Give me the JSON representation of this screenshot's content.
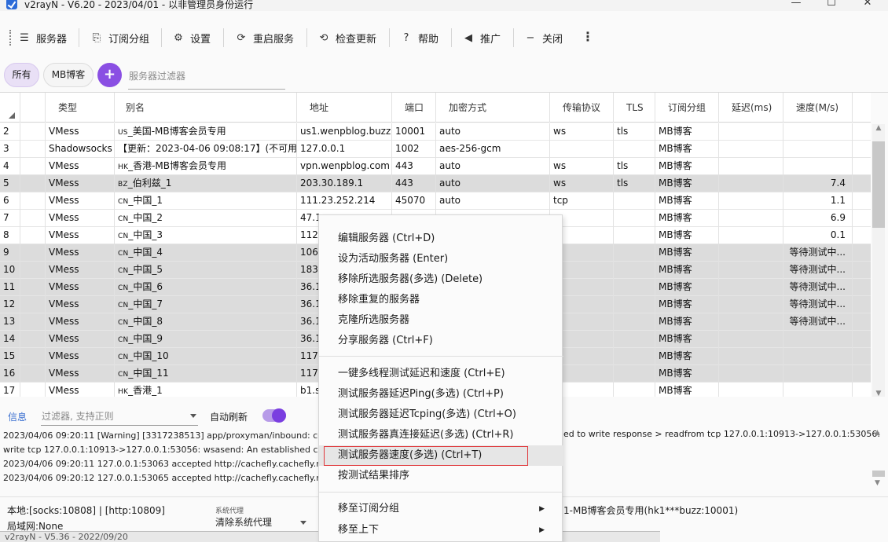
{
  "window": {
    "title": "v2rayN - V6.20 - 2023/04/01 - 以非管理员身份运行",
    "min": "—",
    "max": "☐",
    "close": "✕"
  },
  "toolbar": {
    "servers": "服务器",
    "subs": "订阅分组",
    "settings": "设置",
    "restart": "重启服务",
    "update": "检查更新",
    "help": "帮助",
    "promo": "推广",
    "close": "关闭",
    "more": "⋮"
  },
  "filters": {
    "all": "所有",
    "mb": "MB博客",
    "add": "+",
    "placeholder": "服务器过滤器"
  },
  "grid": {
    "headers": [
      "类型",
      "别名",
      "地址",
      "端口",
      "加密方式",
      "传输协议",
      "TLS",
      "订阅分组",
      "延迟(ms)",
      "速度(M/s)"
    ],
    "rows": [
      {
        "n": "2",
        "type": "VMess",
        "cc": "US",
        "alias": "_美国-MB博客会员专用",
        "addr": "us1.wenpblog.buzz",
        "port": "10001",
        "enc": "auto",
        "net": "ws",
        "tls": "tls",
        "sub": "MB博客",
        "delay": "",
        "speed": "",
        "sel": false
      },
      {
        "n": "3",
        "type": "Shadowsocks",
        "cc": "",
        "alias": "【更新：2023-04-06 09:08:17】(不可用)",
        "addr": "127.0.0.1",
        "port": "1002",
        "enc": "aes-256-gcm",
        "net": "",
        "tls": "",
        "sub": "MB博客",
        "delay": "",
        "speed": "",
        "sel": false
      },
      {
        "n": "4",
        "type": "VMess",
        "cc": "HK",
        "alias": "_香港-MB博客会员专用",
        "addr": "vpn.wenpblog.com",
        "port": "443",
        "enc": "auto",
        "net": "ws",
        "tls": "tls",
        "sub": "MB博客",
        "delay": "",
        "speed": "",
        "sel": false
      },
      {
        "n": "5",
        "type": "VMess",
        "cc": "BZ",
        "alias": "_伯利兹_1",
        "addr": "203.30.189.1",
        "port": "443",
        "enc": "auto",
        "net": "ws",
        "tls": "tls",
        "sub": "MB博客",
        "delay": "",
        "speed": "7.4",
        "sel": true
      },
      {
        "n": "6",
        "type": "VMess",
        "cc": "CN",
        "alias": "_中国_1",
        "addr": "111.23.252.214",
        "port": "45070",
        "enc": "auto",
        "net": "tcp",
        "tls": "",
        "sub": "MB博客",
        "delay": "",
        "speed": "1.1",
        "sel": false
      },
      {
        "n": "7",
        "type": "VMess",
        "cc": "CN",
        "alias": "_中国_2",
        "addr": "47.1",
        "port": "",
        "enc": "",
        "net": "p",
        "tls": "",
        "sub": "MB博客",
        "delay": "",
        "speed": "6.9",
        "sel": false
      },
      {
        "n": "8",
        "type": "VMess",
        "cc": "CN",
        "alias": "_中国_3",
        "addr": "112.",
        "port": "",
        "enc": "",
        "net": "p",
        "tls": "",
        "sub": "MB博客",
        "delay": "",
        "speed": "0.1",
        "sel": false
      },
      {
        "n": "9",
        "type": "VMess",
        "cc": "CN",
        "alias": "_中国_4",
        "addr": "106.",
        "port": "",
        "enc": "",
        "net": "p",
        "tls": "",
        "sub": "MB博客",
        "delay": "",
        "speed": "等待测试中...",
        "sel": true
      },
      {
        "n": "10",
        "type": "VMess",
        "cc": "CN",
        "alias": "_中国_5",
        "addr": "183.",
        "port": "",
        "enc": "",
        "net": "p",
        "tls": "",
        "sub": "MB博客",
        "delay": "",
        "speed": "等待测试中...",
        "sel": true
      },
      {
        "n": "11",
        "type": "VMess",
        "cc": "CN",
        "alias": "_中国_6",
        "addr": "36.1",
        "port": "",
        "enc": "",
        "net": "p",
        "tls": "",
        "sub": "MB博客",
        "delay": "",
        "speed": "等待测试中...",
        "sel": true
      },
      {
        "n": "12",
        "type": "VMess",
        "cc": "CN",
        "alias": "_中国_7",
        "addr": "36.1",
        "port": "",
        "enc": "",
        "net": "p",
        "tls": "",
        "sub": "MB博客",
        "delay": "",
        "speed": "等待测试中...",
        "sel": true
      },
      {
        "n": "13",
        "type": "VMess",
        "cc": "CN",
        "alias": "_中国_8",
        "addr": "36.1",
        "port": "",
        "enc": "",
        "net": "p",
        "tls": "",
        "sub": "MB博客",
        "delay": "",
        "speed": "等待测试中...",
        "sel": true
      },
      {
        "n": "14",
        "type": "VMess",
        "cc": "CN",
        "alias": "_中国_9",
        "addr": "36.1",
        "port": "",
        "enc": "",
        "net": "p",
        "tls": "",
        "sub": "MB博客",
        "delay": "",
        "speed": "",
        "sel": true
      },
      {
        "n": "15",
        "type": "VMess",
        "cc": "CN",
        "alias": "_中国_10",
        "addr": "117.",
        "port": "",
        "enc": "",
        "net": "p",
        "tls": "",
        "sub": "MB博客",
        "delay": "",
        "speed": "",
        "sel": true
      },
      {
        "n": "16",
        "type": "VMess",
        "cc": "CN",
        "alias": "_中国_11",
        "addr": "117.",
        "port": "",
        "enc": "",
        "net": "p",
        "tls": "",
        "sub": "MB博客",
        "delay": "",
        "speed": "",
        "sel": true
      },
      {
        "n": "17",
        "type": "VMess",
        "cc": "HK",
        "alias": "_香港_1",
        "addr": "b1.s",
        "port": "",
        "enc": "",
        "net": "p",
        "tls": "",
        "sub": "MB博客",
        "delay": "",
        "speed": "",
        "sel": false
      }
    ]
  },
  "log": {
    "title": "信息",
    "filter_placeholder": "过滤器, 支持正则",
    "auto_refresh": "自动刷新",
    "lines": [
      "2023/04/06 09:20:11 [Warning] [3317238513] app/proxyman/inbound: conne",
      "write tcp 127.0.0.1:10913->127.0.0.1:53056: wsasend: An established connecti",
      "2023/04/06 09:20:11 127.0.0.1:53063 accepted http://cachefly.cachefly.net/10",
      "2023/04/06 09:20:12 127.0.0.1:53065 accepted http://cachefly.cachefly.net/10"
    ],
    "line1_tail": "ed to write response > readfrom tcp 127.0.0.1:10913->127.0.0.1:53056:"
  },
  "status": {
    "local": "本地:[socks:10808] | [http:10809]",
    "lan": "局域网:None",
    "sysproxy_label": "系统代理",
    "sysproxy_value": "清除系统代理",
    "current": "1-MB博客会员专用(hk1***buzz:10001)",
    "bg_title": "v2rayN - V5.36 - 2022/09/20"
  },
  "menu": {
    "items": [
      "编辑服务器 (Ctrl+D)",
      "设为活动服务器 (Enter)",
      "移除所选服务器(多选) (Delete)",
      "移除重复的服务器",
      "克隆所选服务器",
      "分享服务器 (Ctrl+F)",
      "一键多线程测试延迟和速度 (Ctrl+E)",
      "测试服务器延迟Ping(多选) (Ctrl+P)",
      "测试服务器延迟Tcping(多选) (Ctrl+O)",
      "测试服务器真连接延迟(多选) (Ctrl+R)",
      "测试服务器速度(多选) (Ctrl+T)",
      "按测试结果排序",
      "移至订阅分组",
      "移至上下"
    ],
    "submenu_arrow": "▶"
  },
  "icons": {
    "servers": "☰",
    "subs": "⎘",
    "settings": "⚙",
    "restart": "⟳",
    "update": "⟲",
    "help": "?",
    "promo": "◀",
    "close": "−"
  }
}
